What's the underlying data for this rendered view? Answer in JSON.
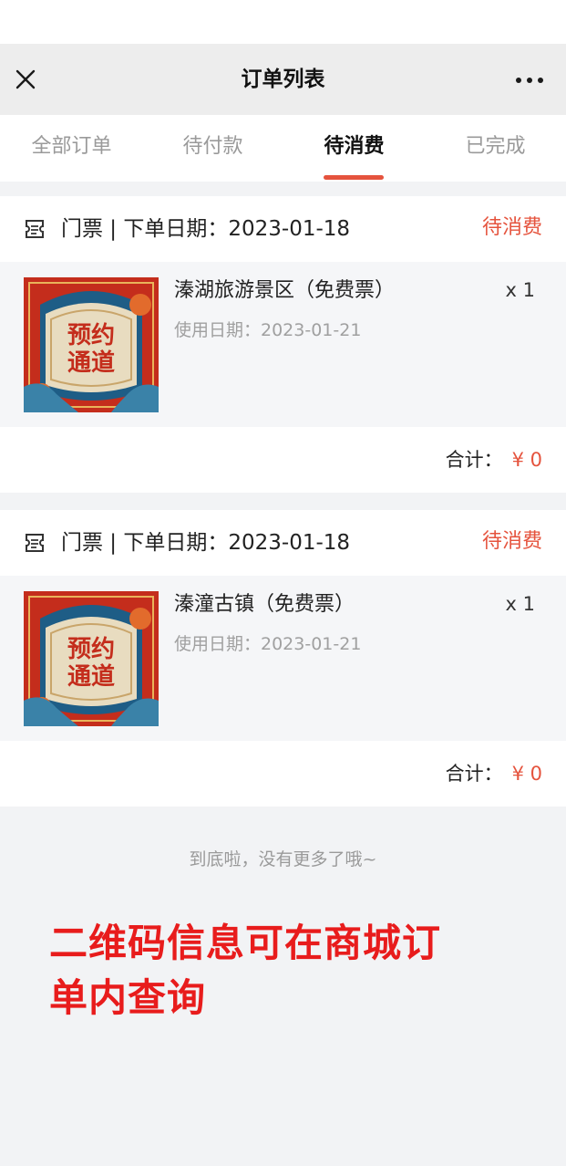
{
  "navbar": {
    "title": "订单列表",
    "close_icon": "close-icon",
    "more_icon": "more-dots-icon"
  },
  "tabs": [
    {
      "label": "全部订单",
      "active": false
    },
    {
      "label": "待付款",
      "active": false
    },
    {
      "label": "待消费",
      "active": true
    },
    {
      "label": "已完成",
      "active": false
    }
  ],
  "orders": [
    {
      "header": "门票 | 下单日期：2023-01-18",
      "status": "待消费",
      "item_name": "溱湖旅游景区（免费票）",
      "use_date": "使用日期：2023-01-21",
      "quantity": "x 1",
      "thumb_text": "预约通道",
      "total_label": "合计：",
      "total_value": "¥ 0"
    },
    {
      "header": "门票 | 下单日期：2023-01-18",
      "status": "待消费",
      "item_name": "溱潼古镇（免费票）",
      "use_date": "使用日期：2023-01-21",
      "quantity": "x 1",
      "thumb_text": "预约通道",
      "total_label": "合计：",
      "total_value": "¥ 0"
    }
  ],
  "end_text": "到底啦，没有更多了哦~",
  "annotation": "二维码信息可在商城订单内查询",
  "colors": {
    "accent": "#e5533d",
    "annotation": "#e81c1c"
  }
}
